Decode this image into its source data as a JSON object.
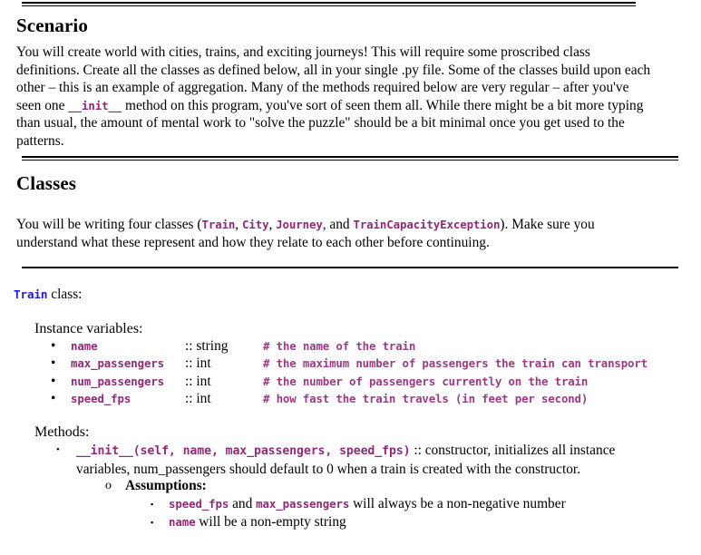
{
  "document": {
    "sections": [
      {
        "heading": "Scenario",
        "paragraph_parts": [
          {
            "type": "text",
            "text": "You will create world with cities, trains, and exciting journeys! This will require some proscribed class definitions. Create all the classes as defined below, all in your single .py file. Some of the classes build upon each other – this is an example of aggregation. Many of the methods required below are very regular – after you've seen one "
          },
          {
            "type": "code",
            "text": "__init__"
          },
          {
            "type": "text",
            "text": " method on this program, you've sort of seen them all. While there might be a bit more typing than usual, the amount of mental work to \"solve the puzzle\" should be a bit minimal once you get used to the patterns."
          }
        ]
      },
      {
        "heading": "Classes",
        "paragraph_parts": [
          {
            "type": "text",
            "text": "You will be writing four classes ("
          },
          {
            "type": "code",
            "text": "Train"
          },
          {
            "type": "text",
            "text": ", "
          },
          {
            "type": "code",
            "text": "City"
          },
          {
            "type": "text",
            "text": ", "
          },
          {
            "type": "code",
            "text": "Journey"
          },
          {
            "type": "text",
            "text": ", and "
          },
          {
            "type": "code",
            "text": "TrainCapacityException"
          },
          {
            "type": "text",
            "text": "). Make sure you understand what these represent and how they relate to each other before continuing."
          }
        ]
      }
    ],
    "class_block": {
      "class_name": "Train",
      "class_suffix": " class:",
      "instance_variables_label": "Instance variables:",
      "instance_variables": [
        {
          "bullet": "•",
          "name": "name",
          "type_sep": ":: ",
          "type": "string",
          "comment": "# the name of the train"
        },
        {
          "bullet": "•",
          "name": "max_passengers",
          "type_sep": ":: ",
          "type": "int",
          "comment": "# the maximum number of passengers the train can transport"
        },
        {
          "bullet": "•",
          "name": "num_passengers",
          "type_sep": ":: ",
          "type": "int",
          "comment": "# the number of passengers currently on the train"
        },
        {
          "bullet": "•",
          "name": "speed_fps",
          "type_sep": ":: ",
          "type": "int",
          "comment": "# how fast the train travels (in feet per second)"
        }
      ],
      "methods_label": "Methods:",
      "method": {
        "bullet": "•",
        "signature": "__init__(self, name, max_passengers, speed_fps)",
        "separator": " :: ",
        "description": "constructor, initializes all instance variables, num_passengers should default to 0 when a train is created with the constructor.",
        "assumptions_bullet": "o",
        "assumptions_label": "Assumptions:",
        "assumptions": [
          {
            "bullet": "▪",
            "parts": [
              {
                "type": "code",
                "text": "speed_fps"
              },
              {
                "type": "text",
                "text": " and "
              },
              {
                "type": "code",
                "text": "max_passengers"
              },
              {
                "type": "text",
                "text": " will always be a non-negative number"
              }
            ]
          },
          {
            "bullet": "▪",
            "parts": [
              {
                "type": "code",
                "text": "name"
              },
              {
                "type": "text",
                "text": " will be a non-empty string"
              }
            ]
          }
        ]
      }
    },
    "colors": {
      "code_purple": "#8f2a7a",
      "code_blue": "#1b1bcc",
      "comment_purple": "#9c3a86",
      "text_black": "#000000",
      "background": "#ffffff"
    }
  }
}
